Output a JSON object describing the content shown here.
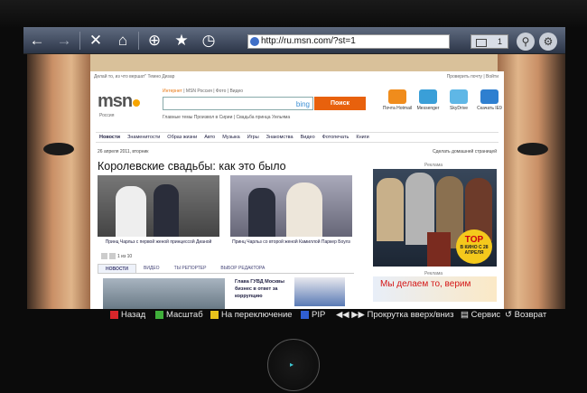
{
  "browser": {
    "url": "http://ru.msn.com/?st=1",
    "tab_count": "1",
    "toolbar_icons": [
      "back-icon",
      "forward-icon",
      "stop-icon",
      "home-icon",
      "zoom-icon",
      "favorite-star-icon",
      "history-icon"
    ]
  },
  "msn": {
    "logo": "msn",
    "logo_region": "Россия",
    "top_prompt": "Делай то, из что вершат\" Темно Дизар",
    "top_right": "Проверить почту | Войти",
    "search_links": {
      "active": "Интернет",
      "rest": " | MSN Россия | Фото | Видео"
    },
    "bing_label": "bing",
    "search_button": "Поиск",
    "trends": "Главные темы   Произвол в Сирии | Свадьба принца Уильяма",
    "services": [
      {
        "label": "Почта Hotmail",
        "color": "#f08c1c"
      },
      {
        "label": "Messenger",
        "color": "#3a9fd8"
      },
      {
        "label": "SkyDrive",
        "color": "#5fb7e6"
      },
      {
        "label": "Скачать IE9",
        "color": "#2e7fd0"
      }
    ],
    "nav": [
      "Новости",
      "Знаменитости",
      "Образ жизни",
      "Авто",
      "Музыка",
      "Игры",
      "Знакомства",
      "Видео",
      "Фотопечать",
      "Книги"
    ],
    "date": "26 апреля 2011, вторник",
    "make_home": "Сделать домашней страницей",
    "headline": "Королевские свадьбы: как это было",
    "captions": [
      "Принц Чарльз с первой женой принцессой Дианой",
      "Принц Чарльз со второй женой Камиллой Паркер Боулз"
    ],
    "pager": "1 из 10",
    "news_tabs": [
      "НОВОСТИ",
      "ВИДЕО",
      "ТЫ РЕПОРТЕР",
      "ВЫБОР РЕДАКТОРА"
    ],
    "news_item": "Глава ГУВД Москвы бизнес в ответ за коррупцию",
    "ad_label": "Реклама",
    "ad_badge_title": "TOP",
    "ad_badge_sub": "В КИНО С 28 АПРЕЛЯ",
    "ad2_text": "Мы делаем то, верим"
  },
  "tv_bar": {
    "back": "Назад",
    "scale": "Масштаб",
    "switch": "На переключение",
    "pip": "PIP",
    "scroll": "Прокрутка вверх/вниз",
    "service": "Сервис",
    "return": "Возврат",
    "colors": {
      "red": "#d8262a",
      "green": "#3fae3a",
      "yellow": "#e8c21c",
      "blue": "#2f5ed0"
    }
  }
}
